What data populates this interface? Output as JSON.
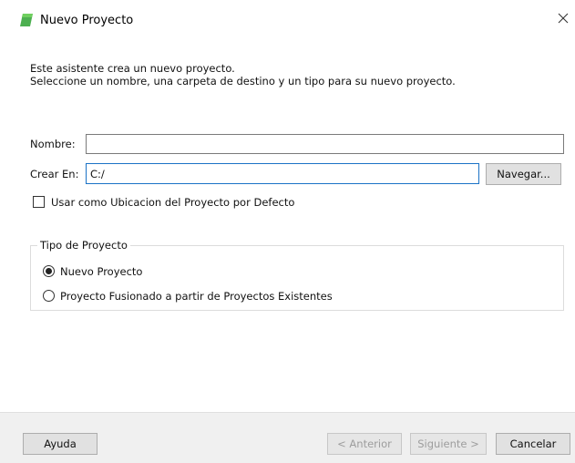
{
  "window": {
    "title": "Nuevo Proyecto",
    "icon": "green-project-icon",
    "close_icon": "close-icon"
  },
  "intro": {
    "line1": "Este asistente crea un nuevo proyecto.",
    "line2": "Seleccione un nombre, una carpeta de destino y un tipo para su nuevo proyecto."
  },
  "form": {
    "name_label": "Nombre:",
    "name_value": "",
    "location_label": "Crear En:",
    "location_value": "C:/",
    "browse_button": "Navegar...",
    "default_checkbox_label": "Usar como Ubicacion del Proyecto por Defecto",
    "default_checkbox_checked": false
  },
  "project_type": {
    "legend": "Tipo de Proyecto",
    "options": [
      {
        "label": "Nuevo Proyecto",
        "selected": true
      },
      {
        "label": "Proyecto Fusionado a partir de Proyectos Existentes",
        "selected": false
      }
    ]
  },
  "footer": {
    "help": "Ayuda",
    "back": "< Anterior",
    "next": "Siguiente >",
    "cancel": "Cancelar"
  },
  "colors": {
    "accent": "#1b73c6",
    "icon_green": "#4caf50"
  }
}
